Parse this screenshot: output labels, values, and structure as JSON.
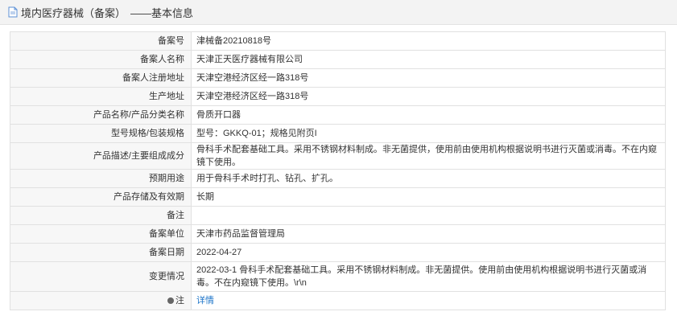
{
  "header": {
    "title": "境内医疗器械（备案）",
    "subtitle": "——基本信息"
  },
  "rows": [
    {
      "label": "备案号",
      "value": "津械备20210818号"
    },
    {
      "label": "备案人名称",
      "value": "天津正天医疗器械有限公司"
    },
    {
      "label": "备案人注册地址",
      "value": "天津空港经济区经一路318号"
    },
    {
      "label": "生产地址",
      "value": "天津空港经济区经一路318号"
    },
    {
      "label": "产品名称/产品分类名称",
      "value": "骨质开口器"
    },
    {
      "label": "型号规格/包装规格",
      "value": "型号：GKKQ-01；规格见附页I"
    },
    {
      "label": "产品描述/主要组成成分",
      "value": "骨科手术配套基础工具。采用不锈钢材料制成。非无菌提供，使用前由使用机构根据说明书进行灭菌或消毒。不在内窥镜下使用。"
    },
    {
      "label": "预期用途",
      "value": "用于骨科手术时打孔、钻孔、扩孔。"
    },
    {
      "label": "产品存储及有效期",
      "value": "长期"
    },
    {
      "label": "备注",
      "value": ""
    },
    {
      "label": "备案单位",
      "value": "天津市药品监督管理局"
    },
    {
      "label": "备案日期",
      "value": "2022-04-27"
    },
    {
      "label": "变更情况",
      "value": "2022-03-1 骨科手术配套基础工具。采用不锈钢材料制成。非无菌提供。使用前由使用机构根据说明书进行灭菌或消毒。不在内窥镜下使用。\\r\\n"
    }
  ],
  "note_row": {
    "label": "注",
    "link": "详情"
  }
}
